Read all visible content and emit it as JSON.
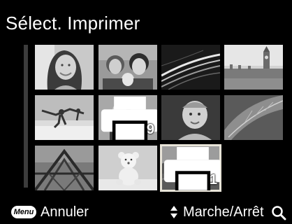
{
  "header": {
    "title": "Sélect. Imprimer"
  },
  "grid": {
    "thumbnails": [
      {
        "subject": "woman-smiling-portrait",
        "copies": "",
        "print_marked": false
      },
      {
        "subject": "family-portrait",
        "copies": "",
        "print_marked": false
      },
      {
        "subject": "night-road-light-trails",
        "copies": "",
        "print_marked": false
      },
      {
        "subject": "big-ben-london",
        "copies": "",
        "print_marked": false
      },
      {
        "subject": "family-beach-jump",
        "copies": "",
        "print_marked": false
      },
      {
        "subject": "two-children",
        "copies": "9",
        "print_marked": true
      },
      {
        "subject": "baby-portrait",
        "copies": "",
        "print_marked": false
      },
      {
        "subject": "leaf-closeup",
        "copies": "",
        "print_marked": false
      },
      {
        "subject": "bridge-structure",
        "copies": "",
        "print_marked": false
      },
      {
        "subject": "teddy-bear",
        "copies": "",
        "print_marked": false
      },
      {
        "subject": "landscape-selected",
        "copies": "1",
        "print_marked": true
      }
    ],
    "selected_index": 10
  },
  "footer": {
    "menu_key": "Menu",
    "cancel_label": "Annuler",
    "toggle_label": "Marche/Arrêt",
    "updown_icon": "up-down-arrows-icon",
    "zoom_icon": "magnifier-icon"
  }
}
